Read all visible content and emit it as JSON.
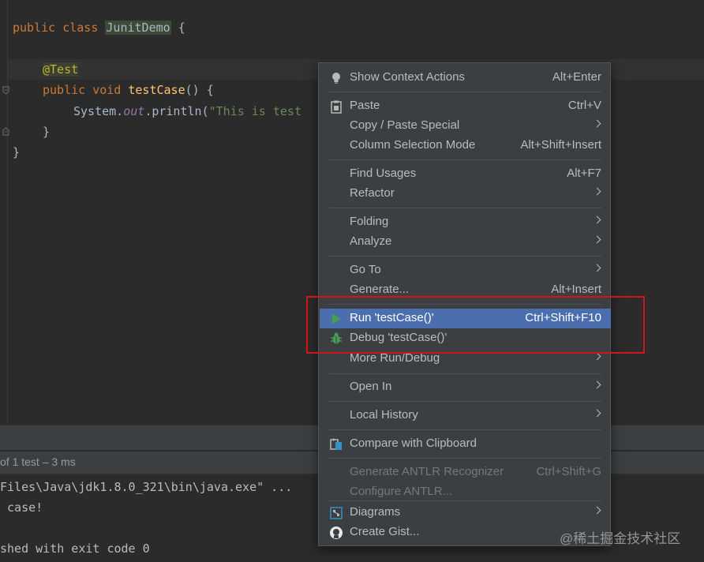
{
  "editor": {
    "line1": {
      "kw": "public class ",
      "cls": "JunitDemo",
      "rest": " {"
    },
    "line3": {
      "ann": "@Test"
    },
    "line4": {
      "kw": "public void ",
      "fn": "testCase",
      "rest": "() {"
    },
    "line5": {
      "pre": "System.",
      "field": "out",
      "mid": ".println(",
      "str": "\"This is test"
    },
    "line6": "}",
    "line7": "}"
  },
  "run_panel": {
    "test_status": "of 1 test – 3 ms",
    "console": [
      "Files\\Java\\jdk1.8.0_321\\bin\\java.exe\" ...",
      " case!",
      "shed with exit code 0"
    ]
  },
  "context_menu": {
    "items": [
      {
        "label": "Show Context Actions",
        "shortcut": "Alt+Enter",
        "icon": "lightbulb-icon"
      },
      {
        "label": "Paste",
        "shortcut": "Ctrl+V",
        "icon": "clipboard-icon"
      },
      {
        "label": "Copy / Paste Special",
        "shortcut": ""
      },
      {
        "label": "Column Selection Mode",
        "shortcut": "Alt+Shift+Insert"
      },
      {
        "label": "Find Usages",
        "shortcut": "Alt+F7"
      },
      {
        "label": "Refactor",
        "shortcut": ""
      },
      {
        "label": "Folding",
        "shortcut": ""
      },
      {
        "label": "Analyze",
        "shortcut": ""
      },
      {
        "label": "Go To",
        "shortcut": ""
      },
      {
        "label": "Generate...",
        "shortcut": "Alt+Insert"
      },
      {
        "label": "Run 'testCase()'",
        "shortcut": "Ctrl+Shift+F10",
        "icon": "run-icon"
      },
      {
        "label": "Debug 'testCase()'",
        "shortcut": "",
        "icon": "bug-icon"
      },
      {
        "label": "More Run/Debug",
        "shortcut": ""
      },
      {
        "label": "Open In",
        "shortcut": ""
      },
      {
        "label": "Local History",
        "shortcut": ""
      },
      {
        "label": "Compare with Clipboard",
        "shortcut": "",
        "icon": "compare-icon"
      },
      {
        "label": "Generate ANTLR Recognizer",
        "shortcut": "Ctrl+Shift+G"
      },
      {
        "label": "Configure ANTLR...",
        "shortcut": ""
      },
      {
        "label": "Diagrams",
        "shortcut": "",
        "icon": "diagram-icon"
      },
      {
        "label": "Create Gist...",
        "shortcut": "",
        "icon": "github-icon"
      }
    ]
  },
  "watermark": "@稀土掘金技术社区",
  "colors": {
    "accent": "#4b6eaf",
    "highlight_box": "#d0161c",
    "run_green": "#499c54"
  }
}
